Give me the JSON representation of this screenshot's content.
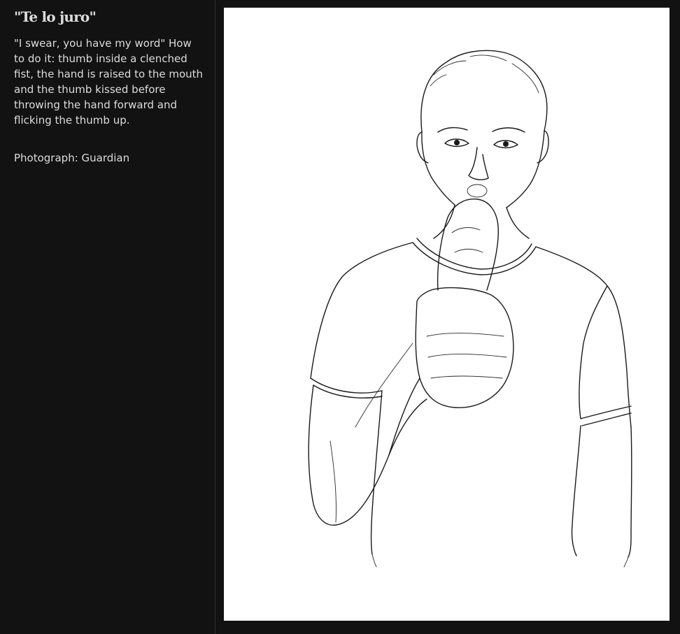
{
  "caption": {
    "title": "\"Te lo juro\"",
    "body": "\"I swear, you have my word\" How to do it: thumb inside a clenched fist, the hand is raised to the mouth and the thumb kissed before throwing the hand forward and flicking the thumb up.",
    "credit": "Photograph: Guardian"
  }
}
